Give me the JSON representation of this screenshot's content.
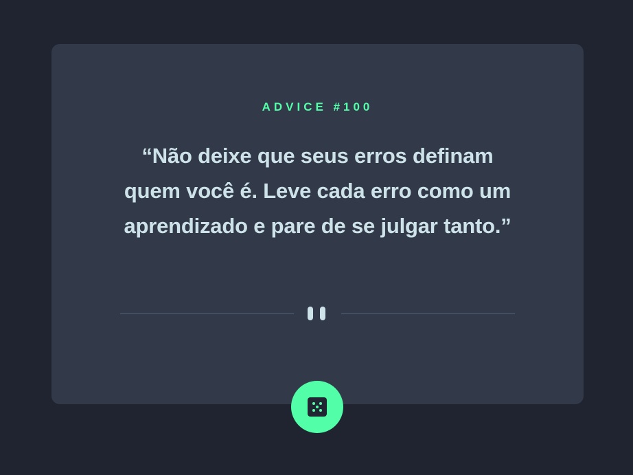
{
  "advice": {
    "id_label": "ADVICE #100",
    "quote": "“Não deixe que seus erros definam quem você é. Leve cada erro como um aprendizado e pare de se julgar tanto.”"
  },
  "divider": {
    "icon": "pause-icon"
  },
  "dice_button": {
    "icon": "dice-icon"
  },
  "colors": {
    "background": "#1f2430",
    "card": "#323a49",
    "accent": "#52ffa8",
    "text": "#cee3e9",
    "divider_line": "#4f5d74"
  }
}
